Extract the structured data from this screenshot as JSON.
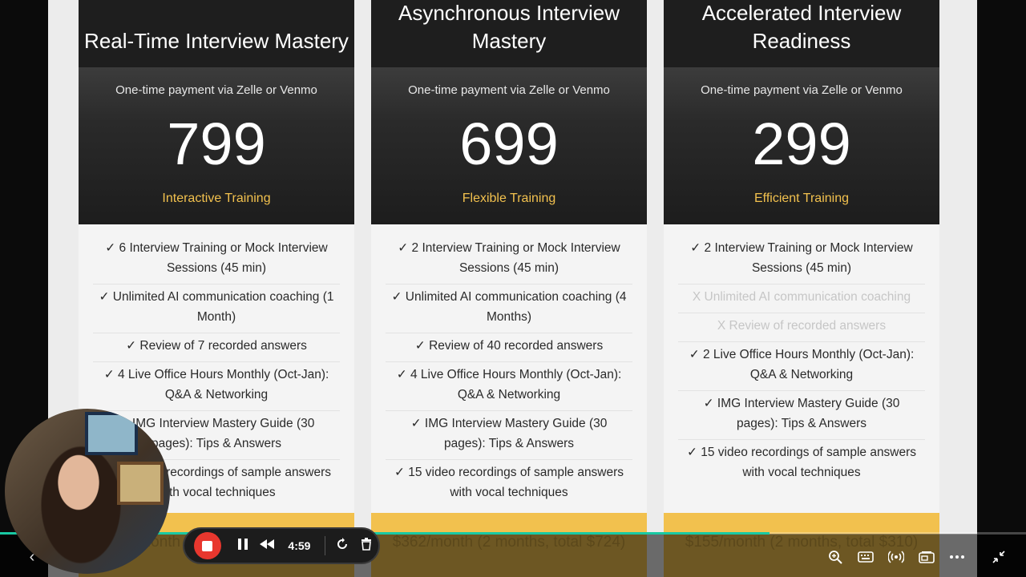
{
  "cards": [
    {
      "title": "Real-Time Interview Mastery",
      "payment_note": "One-time payment via Zelle or Venmo",
      "price": "799",
      "tier": "Interactive Training",
      "features": [
        {
          "text": "✓ 6 Interview Training or Mock Interview Sessions (45 min)",
          "included": true
        },
        {
          "text": "✓ Unlimited AI communication coaching (1 Month)",
          "included": true
        },
        {
          "text": "✓ Review of 7 recorded answers",
          "included": true
        },
        {
          "text": "✓ 4 Live Office Hours Monthly (Oct-Jan): Q&A & Networking",
          "included": true
        },
        {
          "text": "✓ IMG Interview Mastery Guide (30 pages): Tips & Answers",
          "included": true
        },
        {
          "text": "✓ 15 video recordings of sample answers with vocal techniques",
          "included": true
        }
      ],
      "footer": "$400/month (2 months, total $800)"
    },
    {
      "title": "Asynchronous Interview Mastery",
      "payment_note": "One-time payment via Zelle or Venmo",
      "price": "699",
      "tier": "Flexible Training",
      "features": [
        {
          "text": "✓ 2 Interview Training or Mock Interview Sessions (45 min)",
          "included": true
        },
        {
          "text": "✓ Unlimited AI communication coaching (4 Months)",
          "included": true
        },
        {
          "text": "✓ Review of 40 recorded answers",
          "included": true
        },
        {
          "text": "✓ 4 Live Office Hours Monthly (Oct-Jan): Q&A & Networking",
          "included": true
        },
        {
          "text": "✓ IMG Interview Mastery Guide (30 pages): Tips & Answers",
          "included": true
        },
        {
          "text": "✓ 15 video recordings of sample answers with vocal techniques",
          "included": true
        }
      ],
      "footer": "$362/month (2 months, total $724)"
    },
    {
      "title": "Accelerated Interview Readiness",
      "payment_note": "One-time payment via Zelle or Venmo",
      "price": "299",
      "tier": "Efficient Training",
      "features": [
        {
          "text": "✓ 2 Interview Training or Mock Interview Sessions (45 min)",
          "included": true
        },
        {
          "text": "X Unlimited AI communication coaching",
          "included": false
        },
        {
          "text": "X Review of recorded answers",
          "included": false
        },
        {
          "text": "✓ 2 Live Office Hours Monthly (Oct-Jan): Q&A & Networking",
          "included": true
        },
        {
          "text": "✓ IMG Interview Mastery Guide (30 pages): Tips & Answers",
          "included": true
        },
        {
          "text": "✓ 15 video recordings of sample answers with vocal techniques",
          "included": true
        }
      ],
      "footer": "$155/month (2 months, total $310)"
    }
  ],
  "recorder": {
    "time": "4:59",
    "progress_fraction": 0.75,
    "icons": [
      "stop-record-icon",
      "pause-icon",
      "rewind-icon",
      "restart-icon",
      "delete-icon"
    ]
  },
  "toolbar_icons": [
    "zoom-icon",
    "keyboard-icon",
    "broadcast-icon",
    "picture-in-picture-icon",
    "more-icon",
    "collapse-icon"
  ],
  "colors": {
    "header_dark": "#1e1e1e",
    "accent_gold": "#f2c14e",
    "record_red": "#e8372e",
    "progress_teal": "#19c9a3"
  }
}
